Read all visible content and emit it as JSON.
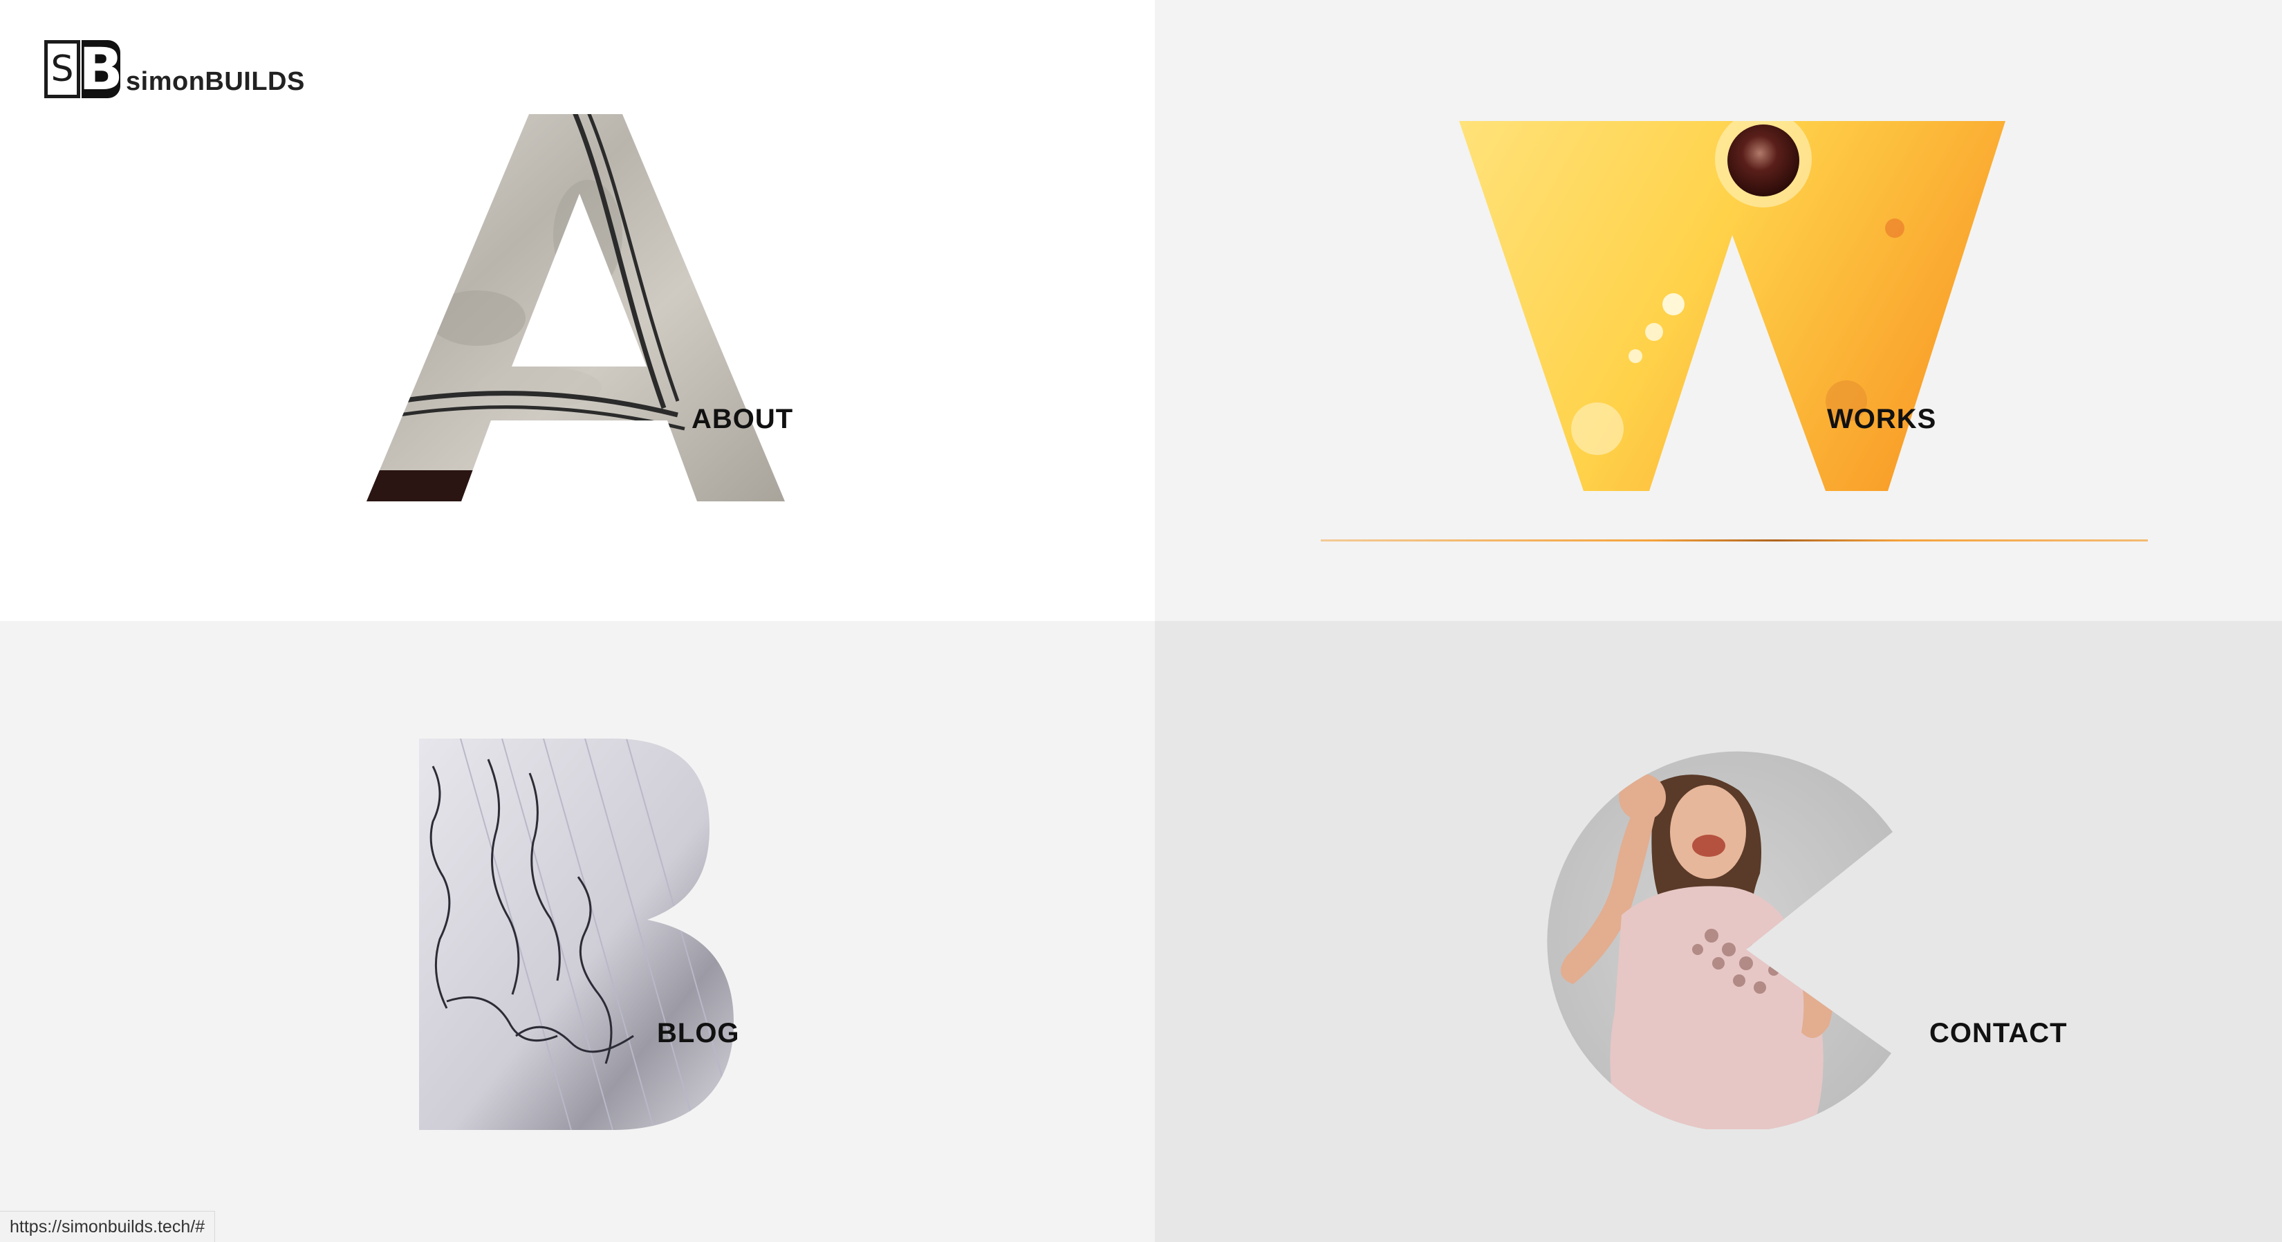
{
  "brand": {
    "mark_s": "S",
    "mark_b": "B",
    "name": "simonBUILDS"
  },
  "nav": {
    "about": "ABOUT",
    "works": "WORKS",
    "blog": "BLOG",
    "contact": "CONTACT"
  },
  "status_bar": {
    "url": "https://simonbuilds.tech/#"
  },
  "colors": {
    "about_bg": "#ffffff",
    "works_bg": "#f3f3f3",
    "blog_bg": "#f3f3f3",
    "contact_bg": "#e7e7e7",
    "accent_orange": "#f5a23a"
  },
  "icons": {
    "about_letter": "letter-a-stone-texture",
    "works_letter": "letter-w-sunlight-texture",
    "blog_letter": "letter-b-handwriting-texture",
    "contact_letter": "letter-c-dancing-woman-photo"
  }
}
